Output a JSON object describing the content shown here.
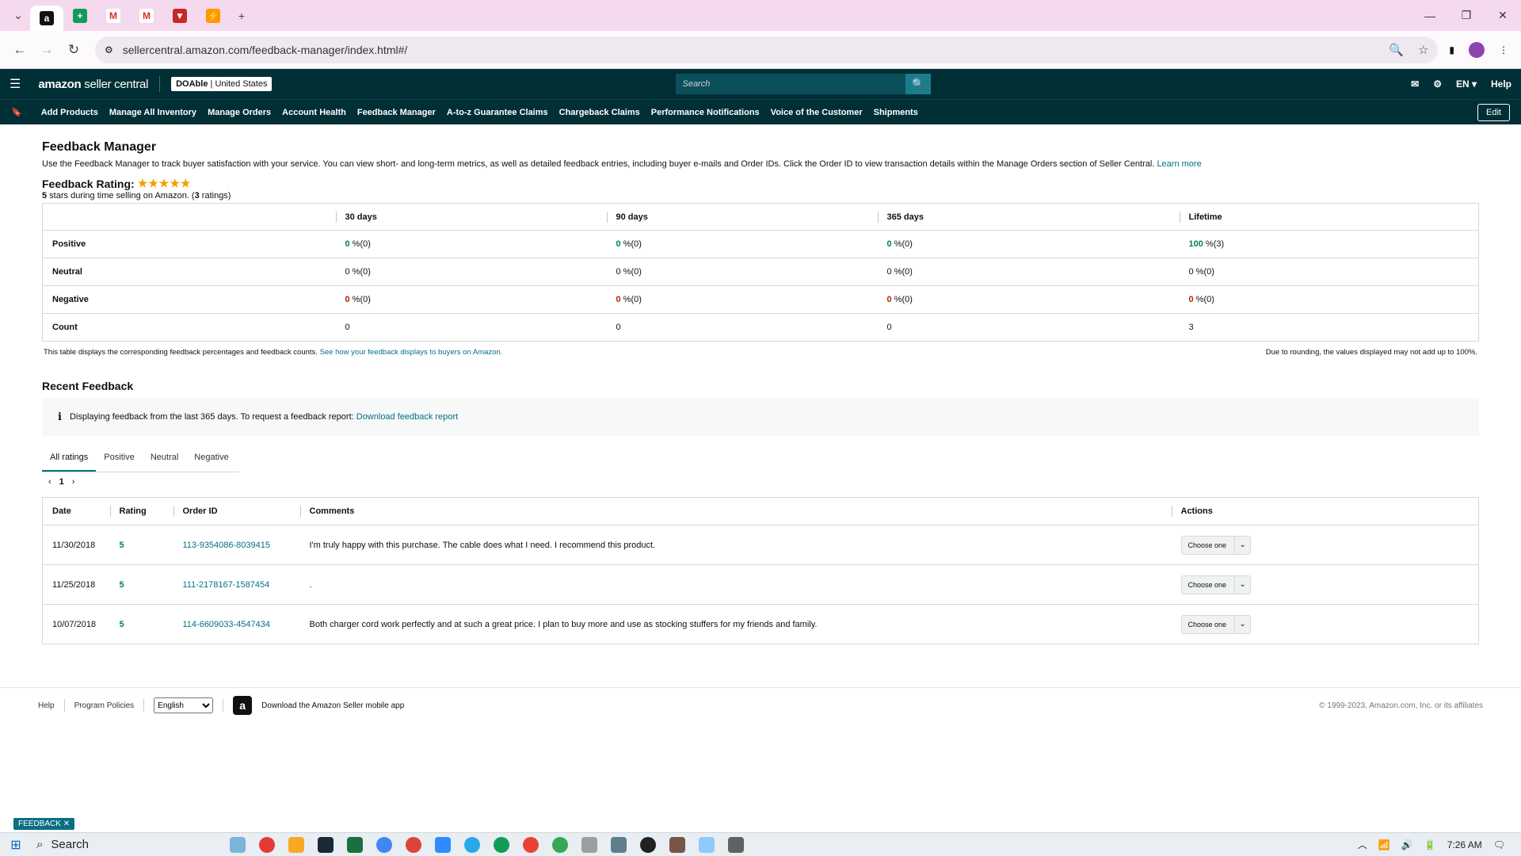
{
  "browser": {
    "url": "sellercentral.amazon.com/feedback-manager/index.html#/",
    "tab_favicons": [
      "amazon-icon",
      "sheets-icon",
      "gmail-icon",
      "gmail-icon",
      "app-icon",
      "app-icon"
    ],
    "new_tab": "+"
  },
  "header": {
    "logo_bold": "amazon",
    "logo_light": " seller central",
    "account_name": "DOAble",
    "account_region": "United States",
    "search_placeholder": "Search",
    "language": "EN",
    "help": "Help"
  },
  "nav": {
    "items": [
      "Add Products",
      "Manage All Inventory",
      "Manage Orders",
      "Account Health",
      "Feedback Manager",
      "A-to-z Guarantee Claims",
      "Chargeback Claims",
      "Performance Notifications",
      "Voice of the Customer",
      "Shipments"
    ],
    "edit": "Edit"
  },
  "page": {
    "title": "Feedback Manager",
    "description": "Use the Feedback Manager to track buyer satisfaction with your service. You can view short- and long-term metrics, as well as detailed feedback entries, including buyer e-mails and Order IDs. Click the Order ID to view transaction details within the Manage Orders section of Seller Central.",
    "learn_more": "Learn more",
    "rating_title": "Feedback Rating:",
    "stars": "★★★★★",
    "rating_value": 5,
    "rating_sub_bold": "5",
    "rating_sub_mid": " stars during time selling on Amazon. (",
    "rating_sub_count": "3",
    "rating_sub_end": " ratings)"
  },
  "metrics": {
    "headers": [
      "",
      "30 days",
      "90 days",
      "365 days",
      "Lifetime"
    ],
    "rows": [
      {
        "label": "Positive",
        "cells": [
          {
            "v": "0",
            "s": " %(0)"
          },
          {
            "v": "0",
            "s": " %(0)"
          },
          {
            "v": "0",
            "s": " %(0)"
          },
          {
            "v": "100",
            "s": " %(3)"
          }
        ]
      },
      {
        "label": "Neutral",
        "cells": [
          {
            "v": "0",
            "s": " %(0)"
          },
          {
            "v": "0",
            "s": " %(0)"
          },
          {
            "v": "0",
            "s": " %(0)"
          },
          {
            "v": "0",
            "s": " %(0)"
          }
        ]
      },
      {
        "label": "Negative",
        "cells": [
          {
            "v": "0",
            "s": " %(0)"
          },
          {
            "v": "0",
            "s": " %(0)"
          },
          {
            "v": "0",
            "s": " %(0)"
          },
          {
            "v": "0",
            "s": " %(0)"
          }
        ]
      },
      {
        "label": "Count",
        "cells": [
          {
            "v": "0",
            "s": ""
          },
          {
            "v": "0",
            "s": ""
          },
          {
            "v": "0",
            "s": ""
          },
          {
            "v": "3",
            "s": ""
          }
        ]
      }
    ],
    "note_left": "This table displays the corresponding feedback percentages and feedback counts.",
    "note_link": "See how your feedback displays to buyers on Amazon.",
    "note_right": "Due to rounding, the values displayed may not add up to 100%."
  },
  "recent": {
    "title": "Recent Feedback",
    "info_text": "Displaying feedback from the last 365 days. To request a feedback report:",
    "info_link": "Download feedback report",
    "tabs": [
      "All ratings",
      "Positive",
      "Neutral",
      "Negative"
    ],
    "page": "1",
    "headers": [
      "Date",
      "Rating",
      "Order ID",
      "Comments",
      "Actions"
    ],
    "rows": [
      {
        "date": "11/30/2018",
        "rating": "5",
        "order": "113-9354086-8039415",
        "comment": "I'm truly happy with this purchase. The cable does what I need. I recommend this product.",
        "action": "Choose one"
      },
      {
        "date": "11/25/2018",
        "rating": "5",
        "order": "111-2178167-1587454",
        "comment": ".",
        "action": "Choose one"
      },
      {
        "date": "10/07/2018",
        "rating": "5",
        "order": "114-6609033-4547434",
        "comment": "Both charger cord work perfectly and at such a great price. I plan to buy more and use as stocking stuffers for my friends and family.",
        "action": "Choose one"
      }
    ]
  },
  "footer": {
    "help": "Help",
    "policies": "Program Policies",
    "language": "English",
    "app_text": "Download the Amazon Seller mobile app",
    "copyright": "© 1999-2023, Amazon.com, Inc. or its affiliates"
  },
  "feedback_tab": "FEEDBACK",
  "taskbar": {
    "search": "Search",
    "time": "7:26 AM"
  },
  "colors": {
    "header_bg": "#002f36",
    "link": "#007185",
    "positive": "#067d62",
    "negative": "#b12704",
    "star": "#f0a000"
  }
}
